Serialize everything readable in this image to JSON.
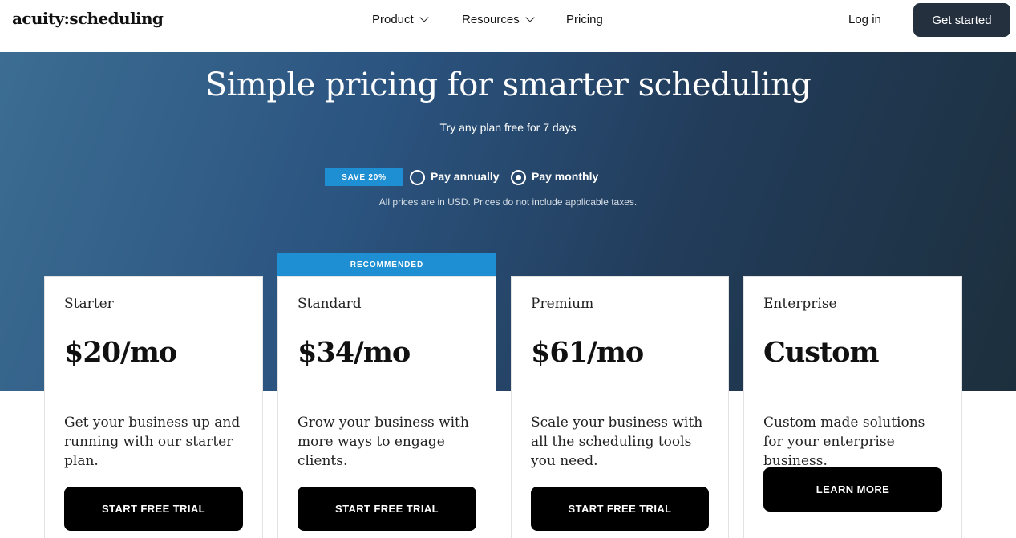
{
  "header": {
    "logo": "acuity:scheduling",
    "nav": [
      {
        "label": "Product"
      },
      {
        "label": "Resources"
      },
      {
        "label": "Pricing"
      }
    ],
    "login_label": "Log in",
    "cta_label": "Get started"
  },
  "hero": {
    "title": "Simple pricing for smarter scheduling",
    "subtitle": "Try any plan free for 7 days",
    "save_badge": "SAVE 20%",
    "billing": {
      "annual_label": "Pay annually",
      "monthly_label": "Pay monthly",
      "selected": "monthly"
    },
    "disclaimer": "All prices are in USD. Prices do not include applicable taxes."
  },
  "recommended_label": "RECOMMENDED",
  "plans": [
    {
      "name": "Starter",
      "price": "$20/mo",
      "description": "Get your business up and running with our starter plan.",
      "cta": "START FREE TRIAL"
    },
    {
      "name": "Standard",
      "price": "$34/mo",
      "description": "Grow your business with more ways to engage clients.",
      "cta": "START FREE TRIAL"
    },
    {
      "name": "Premium",
      "price": "$61/mo",
      "description": "Scale your business with all the scheduling tools you need.",
      "cta": "START FREE TRIAL"
    },
    {
      "name": "Enterprise",
      "price": "Custom",
      "description": "Custom made solutions for your enterprise business.",
      "cta": "LEARN MORE"
    }
  ],
  "colors": {
    "accent": "#1e8fd2",
    "header_button": "#25303f",
    "hero_gradient_start": "#3c6d92",
    "hero_gradient_end": "#1c2f3d"
  }
}
